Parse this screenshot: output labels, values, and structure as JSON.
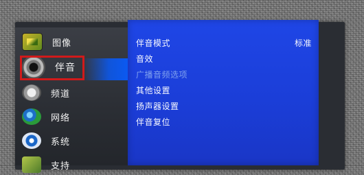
{
  "left_menu": {
    "items": [
      {
        "label": "图像",
        "icon": "picture-icon"
      },
      {
        "label": "伴音",
        "icon": "speaker-icon"
      },
      {
        "label": "频道",
        "icon": "channel-icon"
      },
      {
        "label": "网络",
        "icon": "globe-icon"
      },
      {
        "label": "系统",
        "icon": "gear-icon"
      },
      {
        "label": "支持",
        "icon": "support-icon"
      }
    ],
    "selected_index": 1
  },
  "submenu": {
    "items": [
      {
        "label": "伴音模式",
        "value": "标准",
        "enabled": true
      },
      {
        "label": "音效",
        "value": "",
        "enabled": true
      },
      {
        "label": "广播音频选项",
        "value": "",
        "enabled": false
      },
      {
        "label": "其他设置",
        "value": "",
        "enabled": true
      },
      {
        "label": "扬声器设置",
        "value": "",
        "enabled": true
      },
      {
        "label": "伴音复位",
        "value": "",
        "enabled": true
      }
    ]
  },
  "colors": {
    "submenu_bg": "#1f46e6",
    "highlight_border": "#d11a1a",
    "disabled_text": "#7fa0ee"
  }
}
